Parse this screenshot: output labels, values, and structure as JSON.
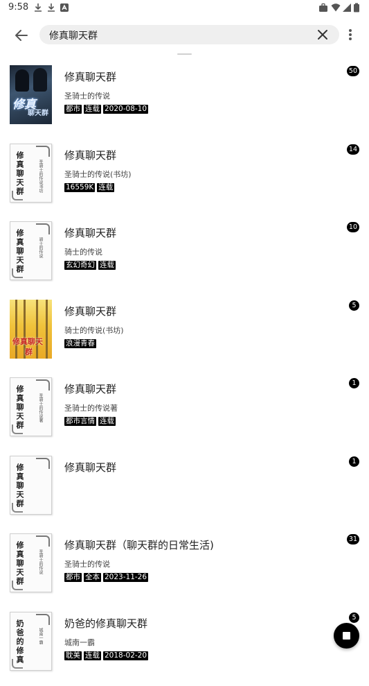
{
  "status_bar": {
    "time": "9:58"
  },
  "search": {
    "query": "修真聊天群"
  },
  "books": [
    {
      "title": "修真聊天群",
      "author": "圣骑士的传说",
      "tags": [
        "都市",
        "连载",
        "2020-08-10"
      ],
      "count": "50",
      "cover_style": "dark",
      "cover_title": "修真",
      "cover_sub": "聊天群"
    },
    {
      "title": "修真聊天群",
      "author": "圣骑士的传说(书坊)",
      "tags": [
        "16559K",
        "连载"
      ],
      "count": "14",
      "cover_style": "plain",
      "cover_title": "修真聊天群",
      "cover_sub": "圣骑士的传说书坊"
    },
    {
      "title": "修真聊天群",
      "author": "骑士的传说",
      "tags": [
        "玄幻奇幻",
        "连载"
      ],
      "count": "10",
      "cover_style": "plain",
      "cover_title": "修真聊天群",
      "cover_sub": "骑士的传说"
    },
    {
      "title": "修真聊天群",
      "author": "骑士的传说(书坊)",
      "tags": [
        "浪漫青春"
      ],
      "count": "5",
      "cover_style": "yellow",
      "cover_title": "修真聊天",
      "cover_sub": "群"
    },
    {
      "title": "修真聊天群",
      "author": "圣骑士的传说著",
      "tags": [
        "都市言情",
        "连载"
      ],
      "count": "1",
      "cover_style": "plain",
      "cover_title": "修真聊天群",
      "cover_sub": "圣骑士的传说著"
    },
    {
      "title": "修真聊天群",
      "author": "",
      "tags": [],
      "count": "1",
      "cover_style": "plain",
      "cover_title": "修真聊天群",
      "cover_sub": ""
    },
    {
      "title": "修真聊天群（聊天群的日常生活)",
      "author": "圣骑士的传说",
      "tags": [
        "都市",
        "全本",
        "2023-11-26"
      ],
      "count": "31",
      "cover_style": "plain",
      "cover_title": "修真聊天群",
      "cover_sub": "圣骑士的传说"
    },
    {
      "title": "奶爸的修真聊天群",
      "author": "城南一霸",
      "tags": [
        "耽美",
        "连载",
        "2018-02-20"
      ],
      "count": "5",
      "cover_style": "plain",
      "cover_title": "奶爸的修真",
      "cover_sub": "城南一霸"
    }
  ],
  "icons": {
    "back": "arrow-left-icon",
    "clear": "close-icon",
    "more": "more-vertical-icon",
    "fab": "stop-icon"
  }
}
